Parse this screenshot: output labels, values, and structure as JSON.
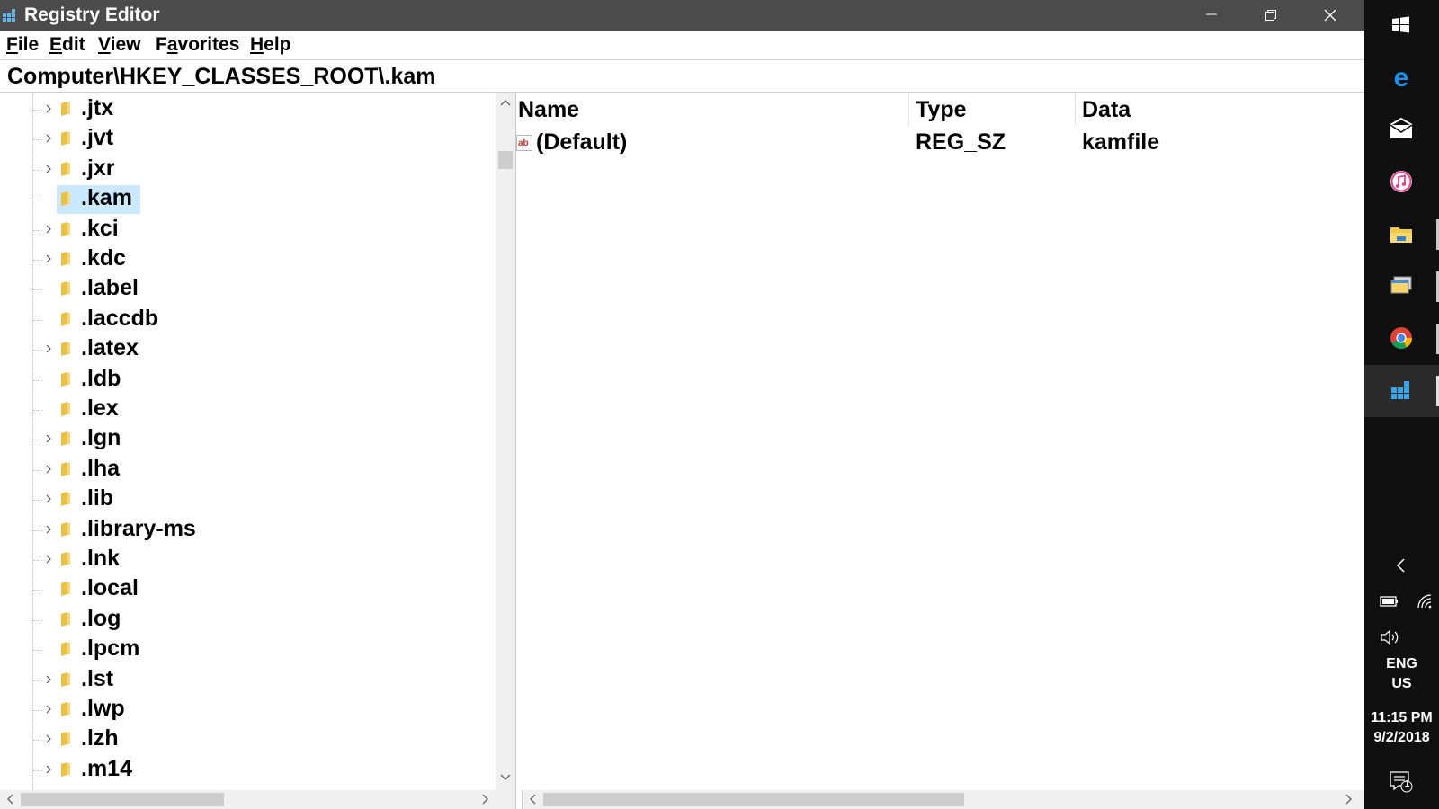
{
  "window": {
    "title": "Registry Editor"
  },
  "menu": {
    "file": {
      "accel": "F",
      "rest": "ile"
    },
    "edit": {
      "accel": "E",
      "rest": "dit"
    },
    "view": {
      "accel": "V",
      "rest": "iew"
    },
    "favorites": {
      "accel": "a",
      "pre": "F",
      "rest": "vorites"
    },
    "help": {
      "accel": "H",
      "rest": "elp"
    }
  },
  "address": "Computer\\HKEY_CLASSES_ROOT\\.kam",
  "tree": {
    "items": [
      {
        "label": ".jtx",
        "expandable": true
      },
      {
        "label": ".jvt",
        "expandable": true
      },
      {
        "label": ".jxr",
        "expandable": true
      },
      {
        "label": ".kam",
        "expandable": false,
        "selected": true
      },
      {
        "label": ".kci",
        "expandable": true
      },
      {
        "label": ".kdc",
        "expandable": true
      },
      {
        "label": ".label",
        "expandable": false
      },
      {
        "label": ".laccdb",
        "expandable": false
      },
      {
        "label": ".latex",
        "expandable": true
      },
      {
        "label": ".ldb",
        "expandable": false
      },
      {
        "label": ".lex",
        "expandable": false
      },
      {
        "label": ".lgn",
        "expandable": true
      },
      {
        "label": ".lha",
        "expandable": true
      },
      {
        "label": ".lib",
        "expandable": true
      },
      {
        "label": ".library-ms",
        "expandable": true
      },
      {
        "label": ".lnk",
        "expandable": true
      },
      {
        "label": ".local",
        "expandable": false
      },
      {
        "label": ".log",
        "expandable": false
      },
      {
        "label": ".lpcm",
        "expandable": false
      },
      {
        "label": ".lst",
        "expandable": true
      },
      {
        "label": ".lwp",
        "expandable": true
      },
      {
        "label": ".lzh",
        "expandable": true
      },
      {
        "label": ".m14",
        "expandable": true
      }
    ]
  },
  "values": {
    "headers": {
      "name": "Name",
      "type": "Type",
      "data": "Data"
    },
    "rows": [
      {
        "name": "(Default)",
        "type": "REG_SZ",
        "data": "kamfile"
      }
    ]
  },
  "taskbar": {
    "language_line1": "ENG",
    "language_line2": "US",
    "time": "11:15 PM",
    "date": "9/2/2018",
    "notification_count": "1"
  },
  "colors": {
    "titlebar": "#4b4b4b",
    "selection": "#cce8ff",
    "folder": "#e8c04a",
    "taskbar": "#101010"
  }
}
